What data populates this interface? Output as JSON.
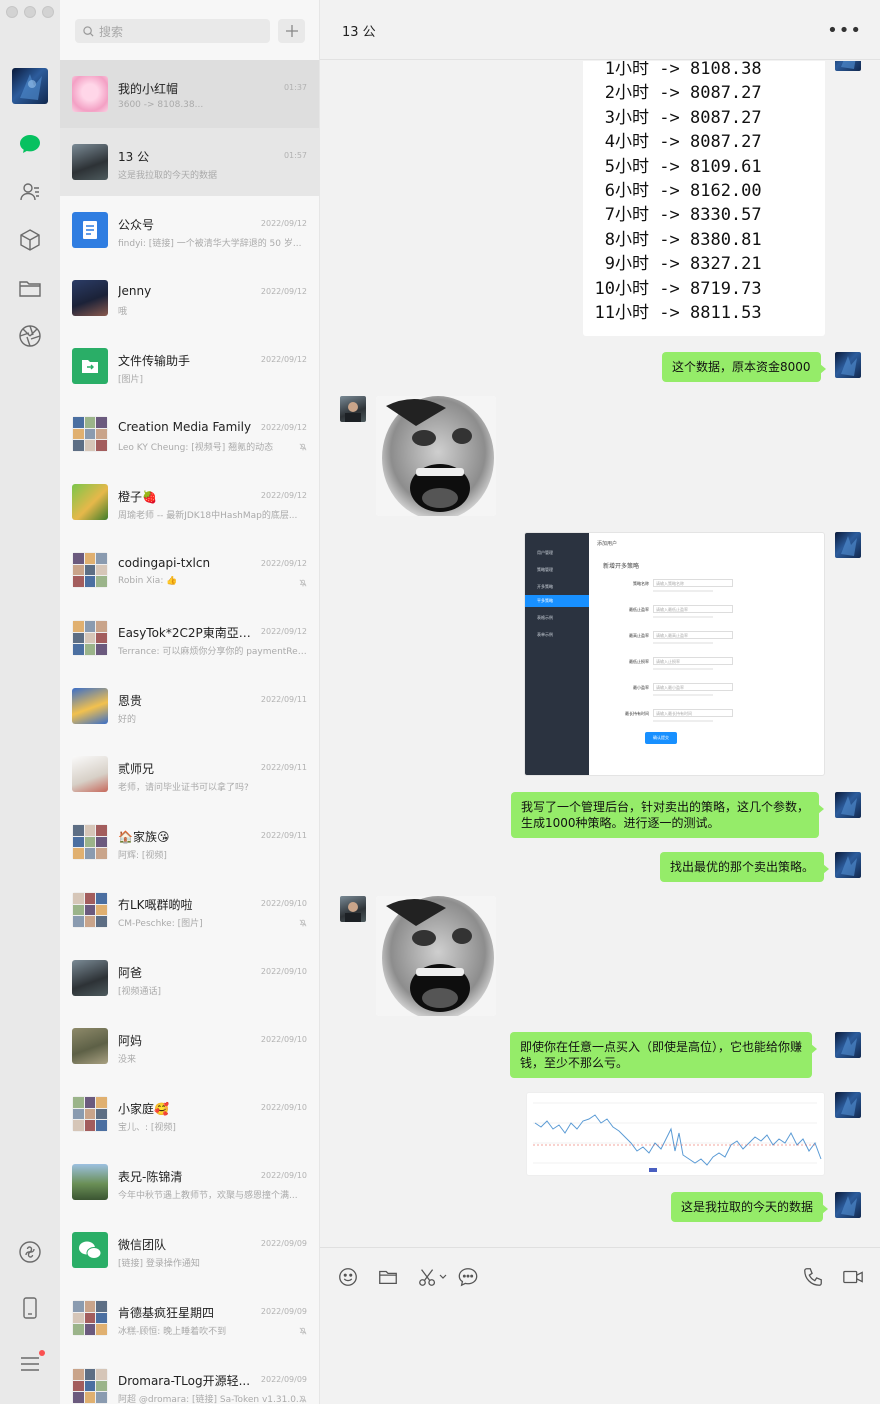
{
  "window_title": "13 公",
  "search": {
    "placeholder": "搜索"
  },
  "nav": {
    "badge_color": "#fa5151",
    "accent": "#07c160"
  },
  "chats": [
    {
      "name": "我的小红帽",
      "time": "01:37",
      "preview": "3600 -> 8108.38...",
      "avatar": "pink-anime-avatar",
      "state": "active"
    },
    {
      "name": "13 公",
      "time": "01:57",
      "preview": "这是我拉取的今天的数据",
      "avatar": "man-photo-avatar",
      "state": "selected"
    },
    {
      "name": "公众号",
      "time": "2022/09/12",
      "preview": "findyi: [链接] 一个被清华大学辞退的 50 岁...",
      "avatar": "official-account-icon"
    },
    {
      "name": "Jenny",
      "time": "2022/09/12",
      "preview": "哦",
      "avatar": "girl-photo-avatar"
    },
    {
      "name": "文件传输助手",
      "time": "2022/09/12",
      "preview": "[图片]",
      "avatar": "file-transfer-icon"
    },
    {
      "name": "Creation Media Family",
      "time": "2022/09/12",
      "preview": "Leo KY Cheung: [视频号] 翘氪的动态",
      "avatar": "group-grid-avatar",
      "muted": true
    },
    {
      "name": "橙子🍓",
      "time": "2022/09/12",
      "preview": "周瑜老师 -- 最新JDK18中HashMap的底层...",
      "avatar": "cat-avatar"
    },
    {
      "name": "codingapi-txlcn",
      "time": "2022/09/12",
      "preview": "Robin Xia: 👍",
      "avatar": "group-grid-avatar",
      "muted": true
    },
    {
      "name": "EasyTok*2C2P東南亞支付",
      "time": "2022/09/12",
      "preview": "Terrance: 可以麻烦你分享你的 paymentReq...",
      "avatar": "group-grid-avatar"
    },
    {
      "name": "恩贵",
      "time": "2022/09/11",
      "preview": "好的",
      "avatar": "cartoon-avatar"
    },
    {
      "name": "贰师兄",
      "time": "2022/09/11",
      "preview": "老师，请问毕业证书可以拿了吗?",
      "avatar": "sketch-avatar"
    },
    {
      "name": "🏠家族😘",
      "time": "2022/09/11",
      "preview": "阿辉: [视频]",
      "avatar": "group-grid-avatar"
    },
    {
      "name": "冇LK嘅群啲啦",
      "time": "2022/09/10",
      "preview": "CM-Peschke: [图片]",
      "avatar": "group-grid-avatar",
      "muted": true
    },
    {
      "name": "阿爸",
      "time": "2022/09/10",
      "preview": "[视频通话]",
      "avatar": "man-photo-avatar"
    },
    {
      "name": "阿妈",
      "time": "2022/09/10",
      "preview": "没来",
      "avatar": "plant-photo-avatar"
    },
    {
      "name": "小家庭🥰",
      "time": "2022/09/10",
      "preview": "宝儿、: [视频]",
      "avatar": "group-grid-avatar"
    },
    {
      "name": "表兄-陈锦清",
      "time": "2022/09/10",
      "preview": "今年中秋节遇上教师节，欢聚与感恩撞个满...",
      "avatar": "outdoor-photo-avatar"
    },
    {
      "name": "微信团队",
      "time": "2022/09/09",
      "preview": "[链接] 登录操作通知",
      "avatar": "wechat-team-icon"
    },
    {
      "name": "肯德基疯狂星期四",
      "time": "2022/09/09",
      "preview": "冰糕-顾恒: 晚上睡着吹不到",
      "avatar": "group-grid-avatar",
      "muted": true
    },
    {
      "name": "Dromara-TLog开源轻...",
      "time": "2022/09/09",
      "preview": "阿超 @dromara: [链接] Sa-Token v1.31.0...",
      "avatar": "group-grid-avatar",
      "muted": true
    }
  ],
  "code_image": {
    "rows": [
      {
        "h": "1小时",
        "v": "8108.38"
      },
      {
        "h": "2小时",
        "v": "8087.27"
      },
      {
        "h": "3小时",
        "v": "8087.27"
      },
      {
        "h": "4小时",
        "v": "8087.27"
      },
      {
        "h": "5小时",
        "v": "8109.61"
      },
      {
        "h": "6小时",
        "v": "8162.00"
      },
      {
        "h": "7小时",
        "v": "8330.57"
      },
      {
        "h": "8小时",
        "v": "8380.81"
      },
      {
        "h": "9小时",
        "v": "8327.21"
      },
      {
        "h": "10小时",
        "v": "8719.73"
      },
      {
        "h": "11小时",
        "v": "8811.53"
      }
    ],
    "arrow": "->"
  },
  "messages": {
    "m1": "这个数据，原本资金8000",
    "m2_line1": "我写了一个管理后台，针对卖出的策略，这几个参数，",
    "m2_line2": "生成1000种策略。进行逐一的测试。",
    "m3": "找出最优的那个卖出策略。",
    "m4_line1": "即使你在任意一点买入（即使是高位），它也能给你赚",
    "m4_line2": "钱，至少不那么亏。",
    "m5": "这是我拉取的今天的数据"
  },
  "admin_screenshot": {
    "sidebar": [
      "用户管理",
      "策略管理",
      "开多策略",
      "平多策略",
      "表格示例",
      "表单示例"
    ],
    "breadcrumb": "添加用户",
    "form_title": "新增开多策略",
    "fields": [
      {
        "label": "策略名称",
        "placeholder": "请输入策略名称"
      },
      {
        "label": "最低止盈率",
        "placeholder": "请输入最低止盈率"
      },
      {
        "label": "最高止盈率",
        "placeholder": "请输入最高止盈率"
      },
      {
        "label": "最低止损率",
        "placeholder": "请输入止损率"
      },
      {
        "label": "最小盈率",
        "placeholder": "请输入最小盈率"
      },
      {
        "label": "最长持有时间",
        "placeholder": "请输入最长持有时间"
      }
    ],
    "submit": "确认提交"
  }
}
